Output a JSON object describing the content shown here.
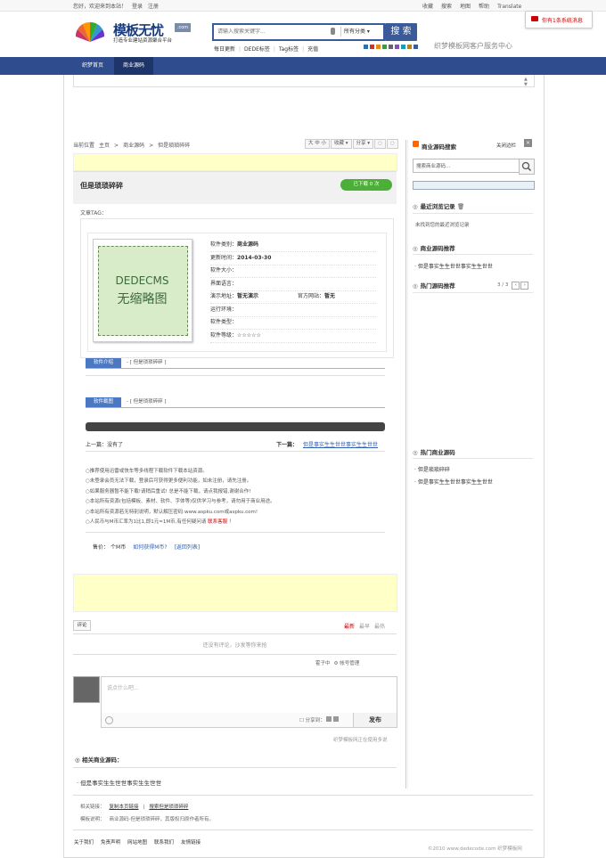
{
  "topbar": {
    "greeting": "您好，欢迎来到本站！",
    "login": "登录",
    "register": "注册",
    "right_links": [
      "收藏",
      "搜索",
      "地图",
      "帮助",
      "Translate"
    ]
  },
  "notice": "你有1条系统消息",
  "logo": {
    "text": "模板无忧",
    "badge": ".com",
    "sub": "打造专业建站资源聚合平台"
  },
  "search": {
    "placeholder": "请输入搜索关键字...",
    "category": "所有分类 ▾",
    "button": "搜 索"
  },
  "hot_links": [
    "每日更新",
    "DEDE标签",
    "Tag标签",
    "充值"
  ],
  "swatch_colors": [
    "#2d6fb3",
    "#c33",
    "#e58d1e",
    "#3a9c3a",
    "#666",
    "#8a4fb3",
    "#1a9ab5",
    "#b5821a",
    "#3b5a9a"
  ],
  "service": "织梦模板网客户服务中心",
  "nav": [
    "织梦首页",
    "商业源码"
  ],
  "breadcrumb": [
    "当前位置",
    "主页",
    ">",
    "商业源码",
    ">",
    "但是琐琐碎碎"
  ],
  "toolbar": [
    "大 中 小",
    "收藏 ▾",
    "分享 ▾",
    "◌",
    "◌"
  ],
  "article": {
    "title": "但是琐琐碎碎",
    "download": "已下载 0 次",
    "tags_label": "文章TAG："
  },
  "thumb": {
    "line1": "DEDECMS",
    "line2": "无缩略图"
  },
  "props": [
    {
      "label": "软件类别：",
      "value": "商业源码"
    },
    {
      "label": "更新时间：",
      "value": "2014-03-30"
    },
    {
      "label": "软件大小：",
      "value": ""
    },
    {
      "label": "界面语言：",
      "value": ""
    },
    {
      "label": "演示地址：",
      "value": "暂无演示"
    },
    {
      "label": "运行环境：",
      "value": ""
    },
    {
      "label": "软件类型：",
      "value": ""
    },
    {
      "label": "软件等级：",
      "value": "☆☆☆☆☆"
    }
  ],
  "official": {
    "label": "官方网站：",
    "value": "暂无"
  },
  "sections": [
    {
      "tab": "软件介绍",
      "desc": "- [ 但是琐琐碎碎 ]"
    },
    {
      "tab": "软件截图",
      "desc": "- [ 但是琐琐碎碎 ]"
    }
  ],
  "prev": "上一篇：没有了",
  "next_label": "下一篇：",
  "next_title": "但是事实生生世世事实生生世世",
  "notes": [
    "○推荐使用迅雷或快车等多线程下载软件下载本站资源。",
    "○未登录会员无法下载，登录后可获得更多便利功能，如未注册，请先注册。",
    "○如果服务器暂不能下载!请稍后重试! 总是不能下载，请点我报错,谢谢合作!",
    "○本站所有资源(包括模板、素材、软件、字体等)仅供学习与参考，请勿用于商业用途。",
    "○本站所有资源若无特别说明，默认解压密码:www.aspku.com或aspku.com!",
    "○人民币与M币汇率为1比1,即1元=1M币,有任何疑问请"
  ],
  "contact": "联系客服",
  "price": {
    "label": "售价：",
    "value": "个M币",
    "how": "如何获得M币?",
    "back": "[返回列表]"
  },
  "comments": {
    "tab": "评论",
    "sorts": [
      "最新",
      "最早",
      "最热"
    ],
    "empty": "还没有评论，沙发等你来抢",
    "tools": [
      "霍子中",
      "⚙ 帐号管理"
    ],
    "placeholder": "说点什么吧...",
    "share": "☐ 分享到：",
    "post": "发布",
    "powered": "织梦模板网正在使用多说"
  },
  "related": {
    "heading": "相关商业源码：",
    "items": [
      "但是事实生生世世事实生生世世"
    ]
  },
  "footer": {
    "related_label": "相关链接：",
    "copy_link": "复制本页链接",
    "search_link": "搜索但是琐琐碎碎",
    "desc_label": "模板说明：",
    "desc": "商业源码-但是琐琐碎碎，其版权归原作者所有。",
    "links": [
      "关于我们",
      "免责声明",
      "网站地图",
      "联系我们",
      "友情链接"
    ],
    "copyright": "©2010 www.dedecode.com 织梦模板网"
  },
  "sidebar": {
    "search_title": "商业源码搜索",
    "close_sidebar": "关闭边栏",
    "search_placeholder": "搜索商业源码...",
    "recent_title": "最近浏览记录",
    "recent_empty": "未找到您的最近浏览记录",
    "recommend_title": "商业源码推荐",
    "recommend_items": [
      "但是事实生生世世事实生生世世"
    ],
    "hot_title": "热门源码推荐",
    "pager": "3 / 3",
    "hot2_title": "热门商业源码",
    "hot2_items": [
      "但是琐琐碎碎",
      "但是事实生生世世事实生生世世"
    ]
  }
}
